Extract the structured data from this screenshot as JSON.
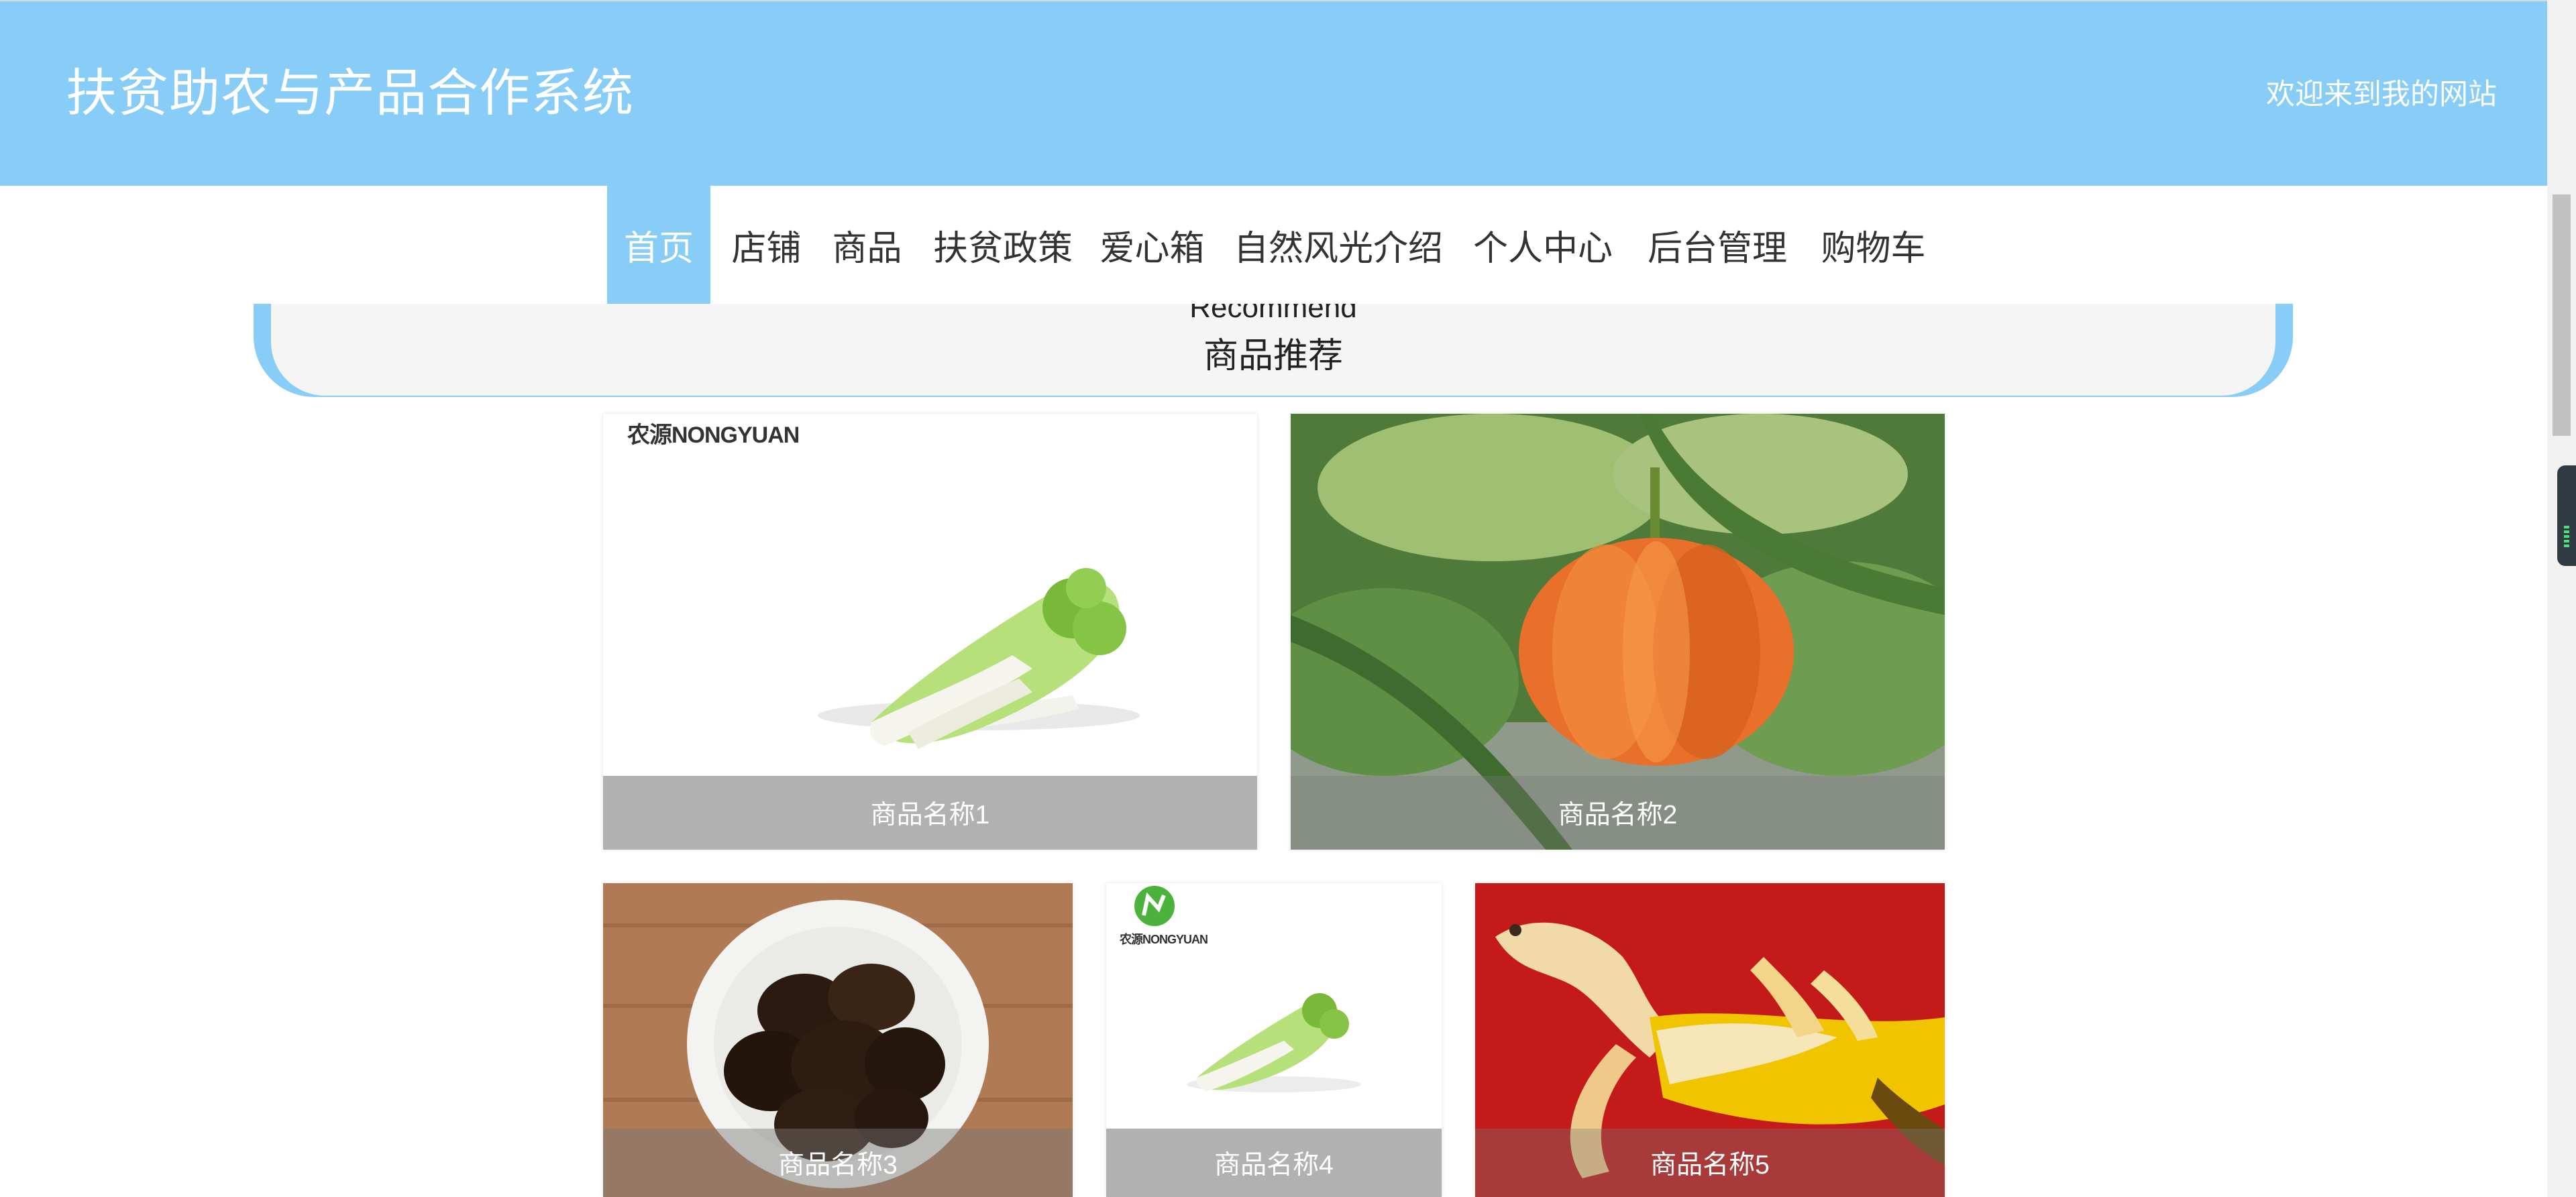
{
  "header": {
    "title": "扶贫助农与产品合作系统",
    "welcome": "欢迎来到我的网站"
  },
  "nav": {
    "items": [
      {
        "label": "首页",
        "active": true
      },
      {
        "label": "店铺"
      },
      {
        "label": "商品"
      },
      {
        "label": "扶贫政策"
      },
      {
        "label": "爱心箱"
      },
      {
        "label": "自然风光介绍"
      },
      {
        "label": "个人中心"
      },
      {
        "label": "后台管理"
      },
      {
        "label": "购物车"
      }
    ]
  },
  "recommend": {
    "title_en": "Recommend",
    "title_cn": "商品推荐"
  },
  "products": [
    {
      "name": "商品名称1",
      "image": "chinese-cabbage",
      "brand": "农源NONGYUAN"
    },
    {
      "name": "商品名称2",
      "image": "pumpkin-on-vine"
    },
    {
      "name": "商品名称3",
      "image": "black-fungus-bowl"
    },
    {
      "name": "商品名称4",
      "image": "chinese-cabbage",
      "brand": "农源NONGYUAN"
    },
    {
      "name": "商品名称5",
      "image": "banana-dog"
    }
  ],
  "colors": {
    "accent": "#87cdf8",
    "banner_bg": "#f5f5f5",
    "caption_bg": "#a0a0a0"
  }
}
